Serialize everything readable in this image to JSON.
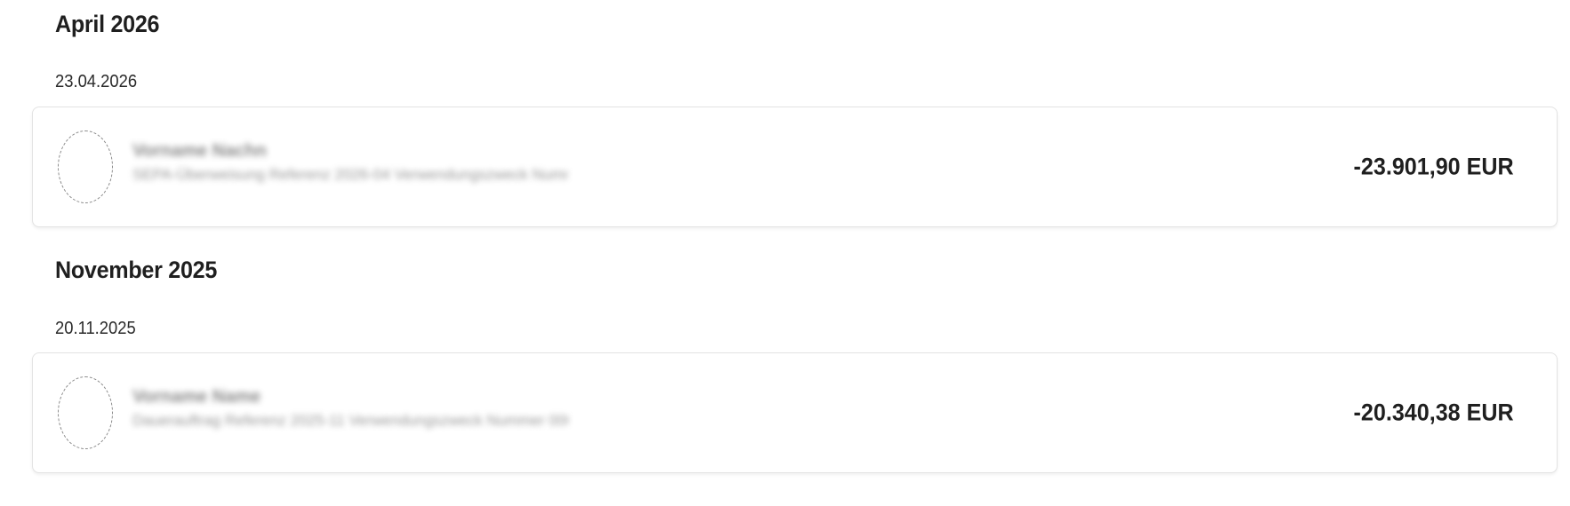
{
  "groups": [
    {
      "month": "April 2026",
      "date": "23.04.2026",
      "transaction": {
        "name": "Vorname Nachname",
        "detail": "SEPA-Überweisung Referenz 2026-04 Verwendungszweck Nummer 00000",
        "amount": "-23.901,90 EUR"
      }
    },
    {
      "month": "November 2025",
      "date": "20.11.2025",
      "transaction": {
        "name": "Vorname Name",
        "detail": "Dauerauftrag Referenz 2025-11 Verwendungszweck Nummer 00000",
        "amount": "-20.340,38 EUR"
      }
    }
  ]
}
